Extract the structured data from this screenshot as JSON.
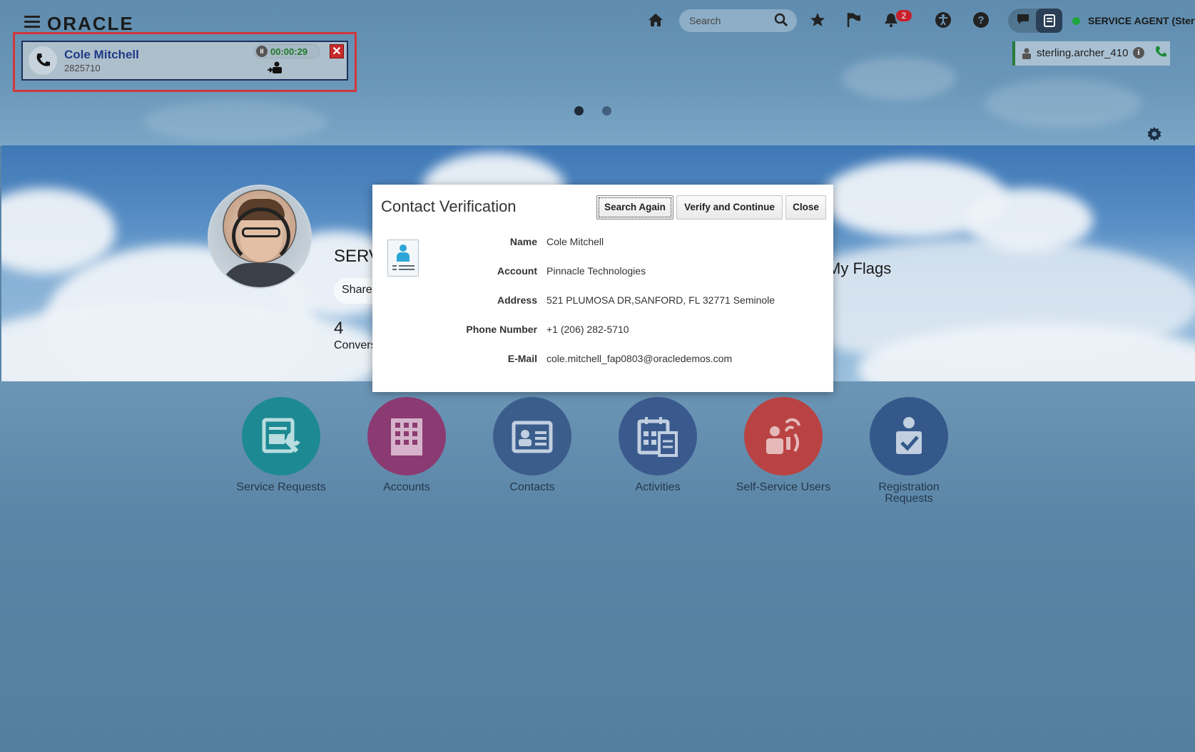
{
  "header": {
    "logo": "ORACLE",
    "search_placeholder": "Search",
    "notification_count": "2",
    "agent_status_label": "SERVICE AGENT (Ster",
    "agent_username": "sterling.archer_410"
  },
  "call_widget": {
    "caller_name": "Cole Mitchell",
    "caller_number": "2825710",
    "timer": "00:00:29"
  },
  "carousel": {
    "pages": 2,
    "active_page": 1
  },
  "hero": {
    "title": "SERV",
    "share_label": "Share",
    "count": "4",
    "count_label": "Convers",
    "flags_title": "My Flags"
  },
  "modal": {
    "title": "Contact Verification",
    "buttons": {
      "search_again": "Search Again",
      "verify_continue": "Verify and Continue",
      "close": "Close"
    },
    "fields": [
      {
        "label": "Name",
        "value": "Cole Mitchell"
      },
      {
        "label": "Account",
        "value": "Pinnacle Technologies"
      },
      {
        "label": "Address",
        "value": "521 PLUMOSA DR,SANFORD, FL 32771 Seminole"
      },
      {
        "label": "Phone Number",
        "value": "+1 (206) 282-5710"
      },
      {
        "label": "E-Mail",
        "value": "cole.mitchell_fap0803@oracledemos.com"
      }
    ]
  },
  "tiles": [
    {
      "label": "Service Requests",
      "color": "#1d8a93"
    },
    {
      "label": "Accounts",
      "color": "#8b3b72"
    },
    {
      "label": "Contacts",
      "color": "#3a5d8c"
    },
    {
      "label": "Activities",
      "color": "#3a5a8e"
    },
    {
      "label": "Self-Service Users",
      "color": "#b94343"
    },
    {
      "label": "Registration Requests",
      "color": "#34588a"
    }
  ],
  "icons": {
    "menu": "hamburger-icon",
    "home": "home-icon",
    "search": "magnifier-icon",
    "favorites": "star-icon",
    "flags": "flag-icon",
    "notifications": "bell-icon",
    "accessibility": "accessibility-icon",
    "help": "question-icon",
    "chat": "chat-bubble-icon",
    "panel": "panel-icon",
    "settings": "gear-icon"
  },
  "colors": {
    "accent_blue": "#1d3b86",
    "online_green": "#1ea53b",
    "alert_red": "#c72b2b"
  }
}
